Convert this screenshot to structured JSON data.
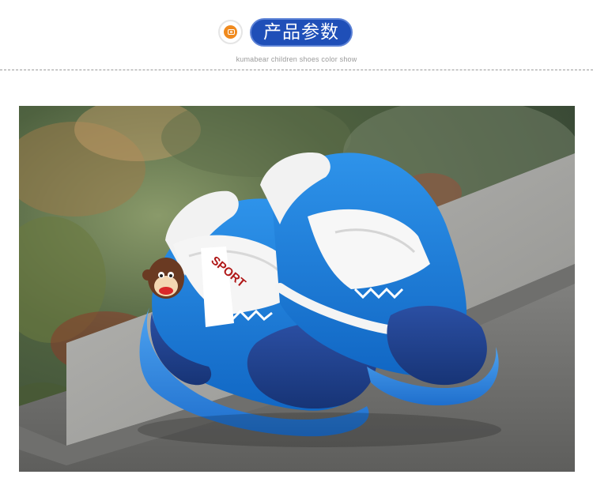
{
  "header": {
    "icon": "camera-icon",
    "title": "产品参数",
    "subtitle": "kumabear children shoes color show",
    "accent": "#1f4fb8",
    "icon_color": "#f08a1e"
  },
  "photo": {
    "description_icon": "product-photo",
    "shoe_label": "SPORT",
    "colors": {
      "upper": "#1e7fd6",
      "suede": "#1f3f8c",
      "strap": "#f4f4f4",
      "sole": "#2f86e0"
    }
  }
}
